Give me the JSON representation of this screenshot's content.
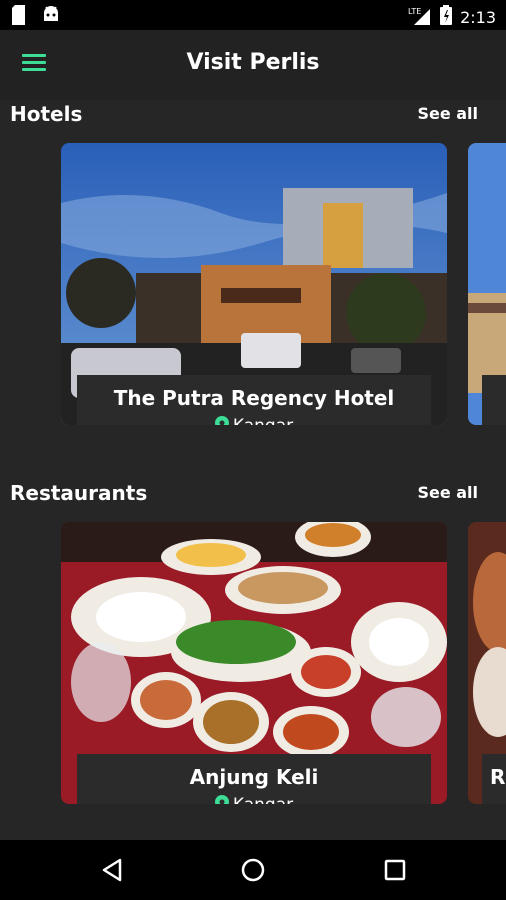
{
  "status_bar": {
    "time": "2:13",
    "network": "LTE"
  },
  "app_bar": {
    "title": "Visit Perlis"
  },
  "hotels": {
    "title": "Hotels",
    "see_all": "See all",
    "cards": [
      {
        "name": "The Putra Regency Hotel",
        "location": "Kangar"
      }
    ]
  },
  "restaurants": {
    "title": "Restaurants",
    "see_all": "See all",
    "cards": [
      {
        "name": "Anjung Keli",
        "location": "Kangar"
      }
    ],
    "peek_initial": "R"
  },
  "colors": {
    "accent": "#3ddc97",
    "background": "#262626",
    "label_bg": "#2b2b2b"
  }
}
